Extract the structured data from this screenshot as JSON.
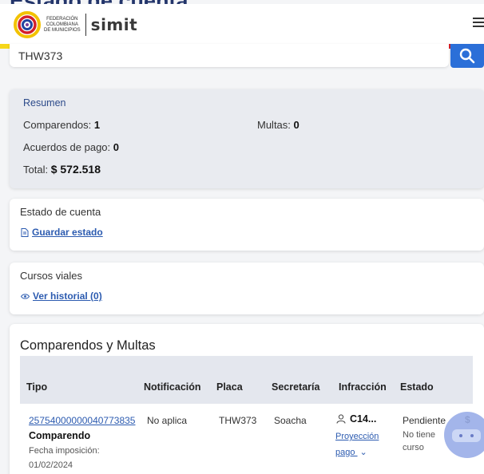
{
  "page": {
    "title_peek": "Estado de cuenta"
  },
  "header": {
    "org_name_lines": [
      "FEDERACIÓN",
      "COLOMBIANA",
      "DE MUNICIPIOS"
    ],
    "brand": "simit",
    "flag_colors": [
      "#f6d71a",
      "#1f3f8f",
      "#d21f2b"
    ]
  },
  "search": {
    "value": "THW373",
    "icon": "search-icon",
    "button_color": "#2b6fd8"
  },
  "summary": {
    "title": "Resumen",
    "comparendos_label": "Comparendos:",
    "comparendos_value": "1",
    "multas_label": "Multas:",
    "multas_value": "0",
    "acuerdos_label": "Acuerdos de pago:",
    "acuerdos_value": "0",
    "total_label": "Total:",
    "total_value": "$ 572.518"
  },
  "estado_cuenta": {
    "label": "Estado de cuenta",
    "link": "Guardar estado",
    "icon": "document-icon"
  },
  "cursos": {
    "label": "Cursos viales",
    "link": "Ver historial (0)",
    "icon": "eye-icon"
  },
  "table": {
    "title": "Comparendos y Multas",
    "headers": [
      "Tipo",
      "Notificación",
      "Placa",
      "Secretaría",
      "Infracción",
      "Estado"
    ],
    "row": {
      "numero": "25754000000040773835",
      "tipo": "Comparendo",
      "fecha_label": "Fecha imposición:",
      "fecha_value": "01/02/2024",
      "notificacion": "No aplica",
      "placa": "THW373",
      "secretaria": "Soacha",
      "infraccion_code": "C14...",
      "proyeccion_line1": "Proyección",
      "proyeccion_line2": "pago",
      "estado": "Pendiente",
      "curso_line1": "No tiene",
      "curso_line2": "curso",
      "extra": "$"
    }
  }
}
